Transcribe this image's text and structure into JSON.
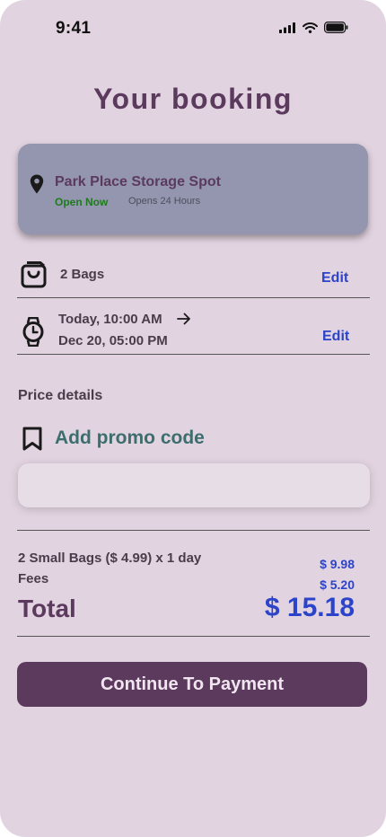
{
  "status_bar": {
    "time": "9:41",
    "icons": [
      "cellular-signal-icon",
      "wifi-icon",
      "battery-icon"
    ]
  },
  "header": {
    "title": "Your booking"
  },
  "location": {
    "name": "Park Place Storage Spot",
    "status": "Open Now",
    "hours": "Opens 24 Hours",
    "icon": "location-pin-icon",
    "colors": {
      "card": "#9396ae",
      "status": "#1f7a1f"
    }
  },
  "bags": {
    "label": "2 Bags",
    "edit_label": "Edit",
    "icon": "shopping-bag-icon"
  },
  "schedule": {
    "start": "Today, 10:00 AM",
    "end": "Dec 20, 05:00 PM",
    "edit_label": "Edit",
    "icon": "watch-icon"
  },
  "pricing": {
    "section_title": "Price details",
    "promo_label": "Add promo code",
    "promo_value": "",
    "lines": [
      {
        "label": "2 Small Bags ($ 4.99) x 1 day",
        "value": "$ 9.98"
      },
      {
        "label": "Fees",
        "value": "$ 5.20"
      }
    ],
    "total_label": "Total",
    "total_value": "$ 15.18"
  },
  "cta": {
    "label": "Continue To Payment"
  },
  "colors": {
    "background": "#e2d3e0",
    "primary": "#5b3a5e",
    "accent": "#2b44c9",
    "promo": "#3d6e6e"
  }
}
